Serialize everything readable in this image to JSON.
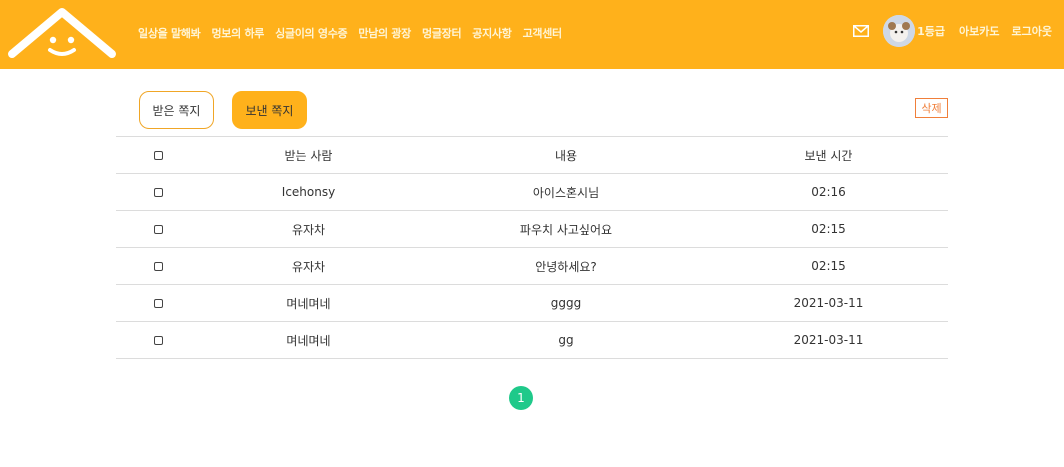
{
  "header": {
    "logo_icon": "smiling-house-logo-icon",
    "nav": [
      "일상을 말해봐",
      "멍보의 하루",
      "싱글이의 영수증",
      "만남의 광장",
      "멍글장터",
      "공지사항",
      "고객센터"
    ],
    "mail_icon": "envelope-icon",
    "grade": "1등급",
    "username": "아보카도",
    "logout": "로그아웃"
  },
  "tabs": {
    "received": "받은 쪽지",
    "sent": "보낸 쪽지"
  },
  "delete_label": "삭제",
  "table": {
    "headers": {
      "receiver": "받는 사람",
      "content": "내용",
      "time": "보낸 시간"
    },
    "rows": [
      {
        "receiver": "Icehonsy",
        "content": "아이스혼시님",
        "time": "02:16"
      },
      {
        "receiver": "유자차",
        "content": "파우치 사고싶어요",
        "time": "02:15"
      },
      {
        "receiver": "유자차",
        "content": "안녕하세요?",
        "time": "02:15"
      },
      {
        "receiver": "며네며네",
        "content": "gggg",
        "time": "2021-03-11"
      },
      {
        "receiver": "며네며네",
        "content": "gg",
        "time": "2021-03-11"
      }
    ]
  },
  "pagination": {
    "current": "1"
  },
  "colors": {
    "header": "#ffb11b",
    "page_active": "#1fc98a",
    "delete": "#f07f3a"
  }
}
